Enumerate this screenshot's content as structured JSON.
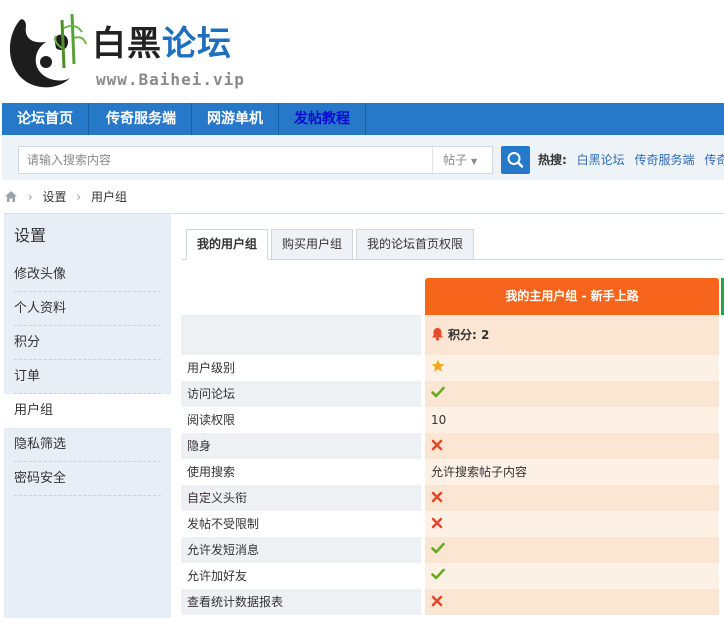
{
  "logo": {
    "title_part1": "白黑",
    "title_part2": "论坛",
    "url": "www.Baihei.vip"
  },
  "nav": {
    "items": [
      "论坛首页",
      "传奇服务端",
      "网游单机",
      "发帖教程"
    ],
    "active_index": 3
  },
  "search": {
    "placeholder": "请输入搜索内容",
    "type_label": "帖子",
    "hot_label": "热搜:",
    "hot_links": [
      "白黑论坛",
      "传奇服务端",
      "传奇"
    ]
  },
  "breadcrumb": {
    "items": [
      "设置",
      "用户组"
    ]
  },
  "sidebar": {
    "title": "设置",
    "items": [
      "修改头像",
      "个人资料",
      "积分",
      "订单",
      "用户组",
      "隐私筛选",
      "密码安全"
    ],
    "active_index": 4
  },
  "tabs": [
    "我的用户组",
    "购买用户组",
    "我的论坛首页权限"
  ],
  "group_header": "我的主用户组 - 新手上路",
  "points_label": "积分: 2",
  "colors": {
    "nav_bg": "#2678c8",
    "header_orange": "#f7641c",
    "check_green": "#6aaa1e",
    "cross_red": "#e5492b",
    "star": "#f5a623"
  },
  "rows": [
    {
      "label": "用户级别",
      "value_type": "star",
      "value": ""
    },
    {
      "label": "访问论坛",
      "value_type": "check",
      "value": ""
    },
    {
      "label": "阅读权限",
      "value_type": "text",
      "value": "10"
    },
    {
      "label": "隐身",
      "value_type": "cross",
      "value": ""
    },
    {
      "label": "使用搜索",
      "value_type": "text",
      "value": "允许搜索帖子内容"
    },
    {
      "label": "自定义头衔",
      "value_type": "cross",
      "value": ""
    },
    {
      "label": "发帖不受限制",
      "value_type": "cross",
      "value": ""
    },
    {
      "label": "允许发短消息",
      "value_type": "check",
      "value": ""
    },
    {
      "label": "允许加好友",
      "value_type": "check",
      "value": ""
    },
    {
      "label": "查看统计数据报表",
      "value_type": "cross",
      "value": ""
    }
  ]
}
